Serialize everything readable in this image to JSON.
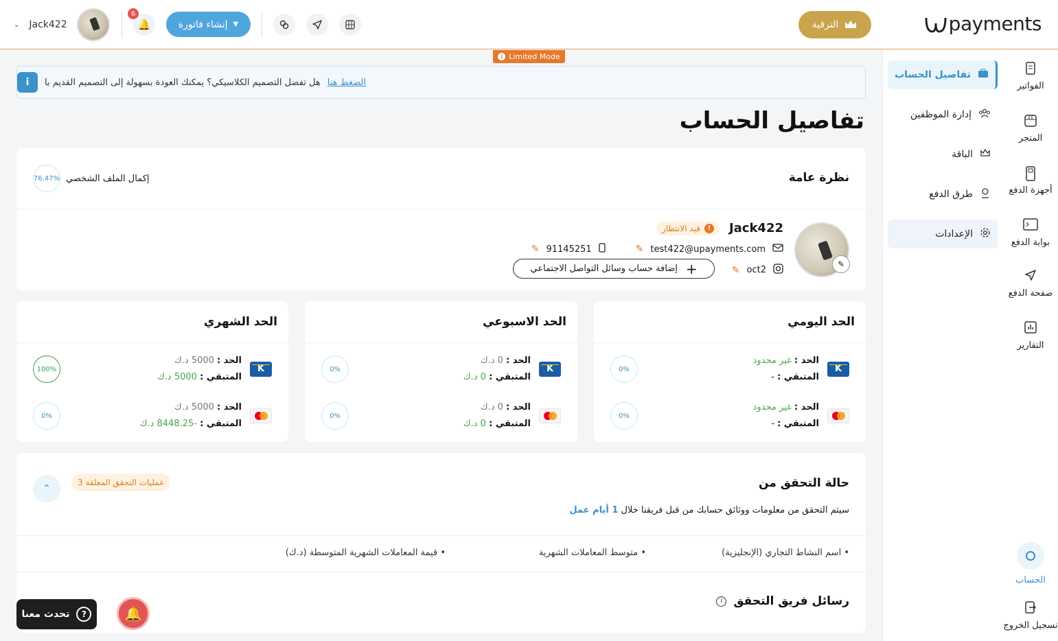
{
  "app": {
    "brand": "payments",
    "limited_mode": "Limited Mode"
  },
  "header": {
    "upgrade_label": "الترقية",
    "create_invoice_label": "إنشاء فاتورة",
    "notification_count": "6",
    "username": "Jack422"
  },
  "rail": {
    "items": [
      {
        "label": "الفواتير",
        "icon": "invoice-icon"
      },
      {
        "label": "المتجر",
        "icon": "store-icon"
      },
      {
        "label": "أجهزة الدفع",
        "icon": "pos-device-icon"
      },
      {
        "label": "بوابة الدفع",
        "icon": "gateway-icon"
      },
      {
        "label": "صفحة الدفع",
        "icon": "send-icon"
      },
      {
        "label": "التقارير",
        "icon": "reports-icon"
      }
    ],
    "account_label": "الحساب",
    "logout_label": "تسجيل الخروج"
  },
  "subnav": {
    "items": [
      {
        "label": "تفاصيل الحساب",
        "icon": "briefcase-icon",
        "state": "active"
      },
      {
        "label": "إدارة الموظفين",
        "icon": "team-icon"
      },
      {
        "label": "الباقة",
        "icon": "crown-icon"
      },
      {
        "label": "طرق الدفع",
        "icon": "payment-method-icon"
      },
      {
        "label": "الإعدادات",
        "icon": "gear-icon"
      }
    ]
  },
  "banner": {
    "text": "هل تفضل التصميم الكلاسيكي؟ يمكنك العودة بسهولة إلى التصميم القديم با",
    "link": "الضغط هنا"
  },
  "page": {
    "title": "تفاصيل الحساب"
  },
  "overview": {
    "title": "نظرة عامة",
    "profile_completion_label": "إكمال الملف الشخصي",
    "profile_completion_pct": "76.47%",
    "name": "Jack422",
    "status": "قيد الانتظار",
    "email": "test422@upayments.com",
    "phone": "91145251",
    "instagram": "oct2",
    "add_social_label": "إضافة حساب وسائل التواصل الاجتماعي"
  },
  "limits": {
    "limit_label": "الحد :",
    "remaining_label": "المتبقي :",
    "daily": {
      "title": "الحد اليومي",
      "knet": {
        "limit": "غير محدود",
        "remaining": "-",
        "pct": "0%"
      },
      "card": {
        "limit": "غير محدود",
        "remaining": "-",
        "pct": "0%"
      }
    },
    "weekly": {
      "title": "الحد الاسبوعي",
      "knet": {
        "limit": "0 د.ك",
        "remaining": "0 د.ك",
        "pct": "0%"
      },
      "card": {
        "limit": "0 د.ك",
        "remaining": "0 د.ك",
        "pct": "0%"
      }
    },
    "monthly": {
      "title": "الحد الشهري",
      "knet": {
        "limit": "5000 د.ك",
        "remaining": "5000 د.ك",
        "pct": "100%"
      },
      "card": {
        "limit": "5000 د.ك",
        "remaining": "-8448.25 د.ك",
        "pct": "0%"
      }
    }
  },
  "verification": {
    "title": "حالة التحقق من",
    "pending_badge": "3 عمليات التحقق المعلقة",
    "desc_prefix": "سيتم التحقق من معلومات ووثائق حسابك من قبل فريقنا خلال",
    "desc_days": "1 أيام عمل",
    "items": [
      "اسم النشاط التجاري (الإنجليزية)",
      "متوسط المعاملات الشهرية",
      "قيمة المعاملات الشهرية المتوسطة (د.ك)"
    ],
    "messages_title": "رسائل فريق التحقق"
  },
  "chat": {
    "label": "تحدث معنا"
  },
  "colors": {
    "accent": "#3a92c9",
    "gold": "#c9a44c",
    "orange": "#e6782b",
    "green": "#4aa34a"
  }
}
